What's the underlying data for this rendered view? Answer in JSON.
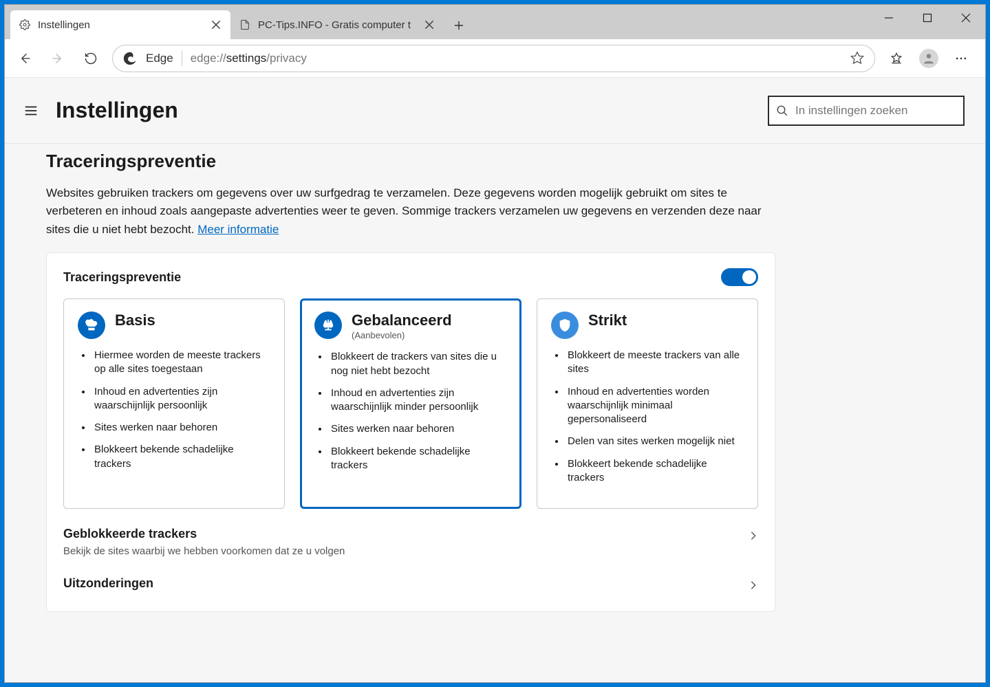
{
  "window": {
    "tabs": [
      {
        "title": "Instellingen",
        "icon": "gear"
      },
      {
        "title": "PC-Tips.INFO - Gratis computer t",
        "icon": "page"
      }
    ]
  },
  "toolbar": {
    "edge_label": "Edge",
    "url_prefix": "edge://",
    "url_mid": "settings",
    "url_suffix": "/privacy"
  },
  "settings": {
    "title": "Instellingen",
    "search_placeholder": "In instellingen zoeken"
  },
  "tracking": {
    "heading": "Traceringspreventie",
    "description": "Websites gebruiken trackers om gegevens over uw surfgedrag te verzamelen. Deze gegevens worden mogelijk gebruikt om sites te verbeteren en inhoud zoals aangepaste advertenties weer te geven. Sommige trackers verzamelen uw gegevens en verzenden deze naar sites die u niet hebt bezocht. ",
    "more_info": "Meer informatie",
    "panel_title": "Traceringspreventie",
    "toggle_on": true,
    "cards": [
      {
        "id": "basic",
        "title": "Basis",
        "subtitle": "",
        "selected": false,
        "bullets": [
          "Hiermee worden de meeste trackers op alle sites toegestaan",
          "Inhoud en advertenties zijn waarschijnlijk persoonlijk",
          "Sites werken naar behoren",
          "Blokkeert bekende schadelijke trackers"
        ]
      },
      {
        "id": "balanced",
        "title": "Gebalanceerd",
        "subtitle": "(Aanbevolen)",
        "selected": true,
        "bullets": [
          "Blokkeert de trackers van sites die u nog niet hebt bezocht",
          "Inhoud en advertenties zijn waarschijnlijk minder persoonlijk",
          "Sites werken naar behoren",
          "Blokkeert bekende schadelijke trackers"
        ]
      },
      {
        "id": "strict",
        "title": "Strikt",
        "subtitle": "",
        "selected": false,
        "bullets": [
          "Blokkeert de meeste trackers van alle sites",
          "Inhoud en advertenties worden waarschijnlijk minimaal gepersonaliseerd",
          "Delen van sites werken mogelijk niet",
          "Blokkeert bekende schadelijke trackers"
        ]
      }
    ],
    "blocked": {
      "title": "Geblokkeerde trackers",
      "desc": "Bekijk de sites waarbij we hebben voorkomen dat ze u volgen"
    },
    "exceptions": {
      "title": "Uitzonderingen"
    }
  }
}
